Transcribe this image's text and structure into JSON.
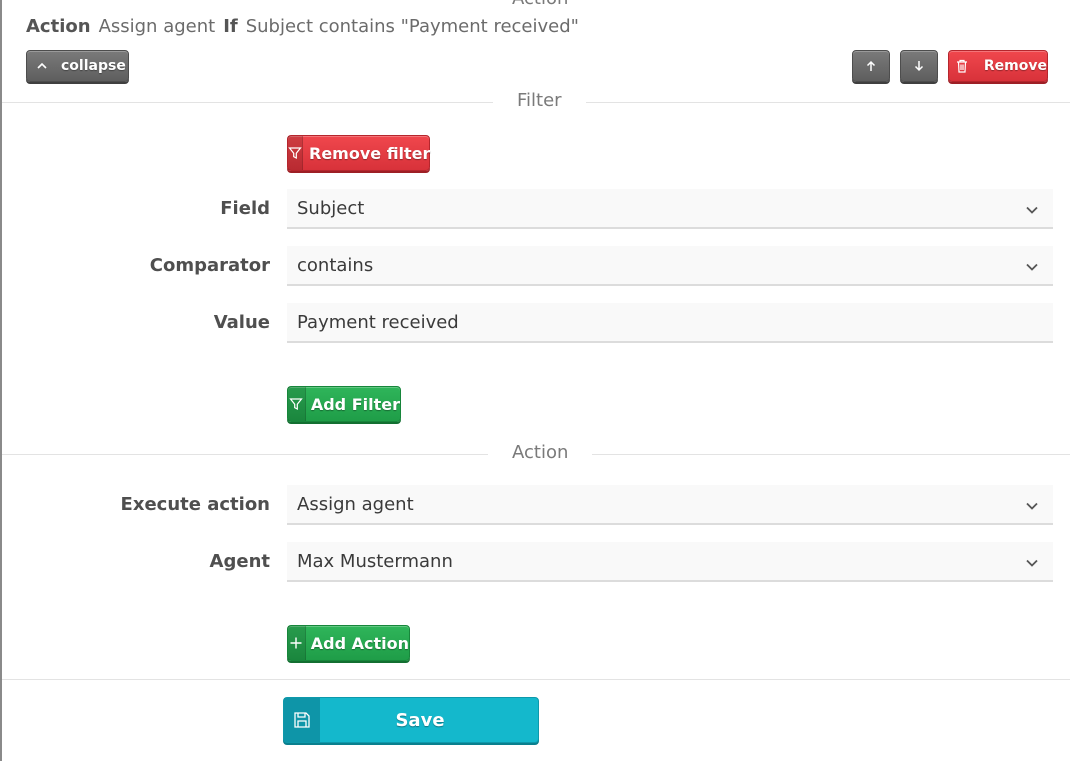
{
  "top_cut_heading": "Action",
  "summary": {
    "action_kw": "Action",
    "action_value": "Assign agent",
    "if_kw": "If",
    "condition": "Subject contains \"Payment received\""
  },
  "toolbar": {
    "collapse_label": "collapse",
    "remove_label": "Remove"
  },
  "filter_section": {
    "title": "Filter",
    "remove_filter_label": "Remove filter",
    "field_label": "Field",
    "field_value": "Subject",
    "comparator_label": "Comparator",
    "comparator_value": "contains",
    "value_label": "Value",
    "value_value": "Payment received",
    "add_filter_label": "Add Filter"
  },
  "action_section": {
    "title": "Action",
    "execute_label": "Execute action",
    "execute_value": "Assign agent",
    "agent_label": "Agent",
    "agent_value": "Max Mustermann",
    "add_action_label": "Add Action"
  },
  "save_label": "Save",
  "colors": {
    "grey_button": "#6b6b6b",
    "red_button": "#e53940",
    "green_button": "#27a850",
    "teal_button": "#14b8cc"
  },
  "icons": {
    "collapse": "chevron-up-icon",
    "move_up": "arrow-up-icon",
    "move_down": "arrow-down-icon",
    "remove": "trash-icon",
    "filter": "filter-icon",
    "add": "plus-icon",
    "save": "floppy-disk-icon",
    "select": "chevron-down-icon"
  }
}
